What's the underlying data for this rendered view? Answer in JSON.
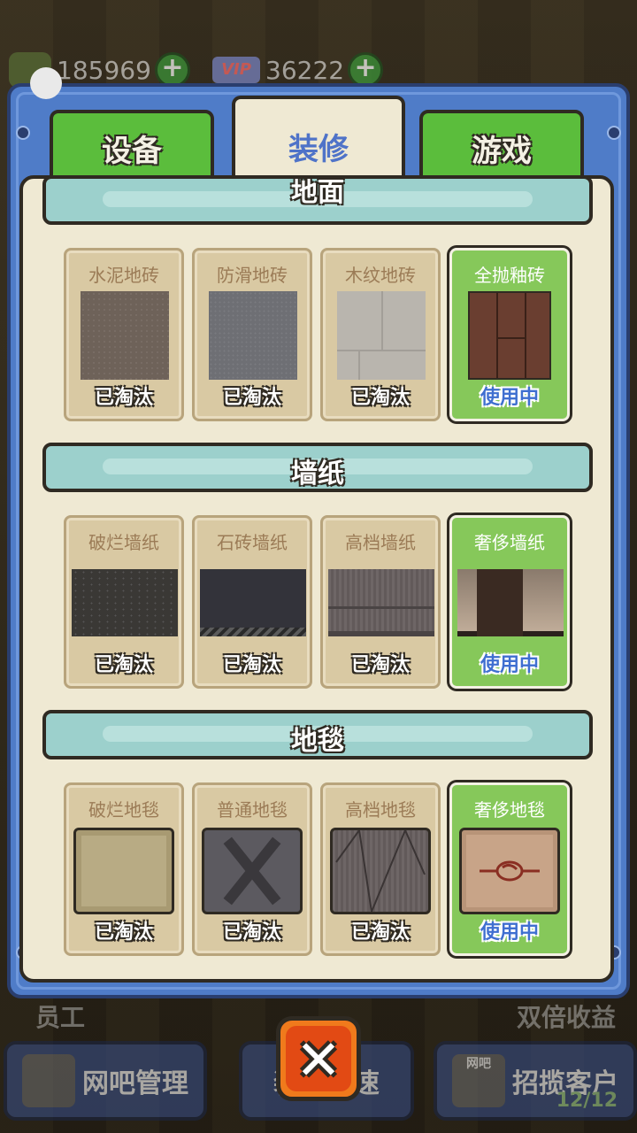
{
  "topbar": {
    "coins": "185969",
    "vip_points": "36222",
    "plus": "+"
  },
  "tabs": [
    {
      "label": "设备",
      "active": false
    },
    {
      "label": "装修",
      "active": true
    },
    {
      "label": "游戏",
      "active": false
    }
  ],
  "sections": [
    {
      "title": "地面",
      "items": [
        {
          "name": "水泥地砖",
          "status": "已淘汰"
        },
        {
          "name": "防滑地砖",
          "status": "已淘汰"
        },
        {
          "name": "木纹地砖",
          "status": "已淘汰"
        },
        {
          "name": "全抛釉砖",
          "status": "使用中"
        }
      ]
    },
    {
      "title": "墙纸",
      "items": [
        {
          "name": "破烂墙纸",
          "status": "已淘汰"
        },
        {
          "name": "石砖墙纸",
          "status": "已淘汰"
        },
        {
          "name": "高档墙纸",
          "status": "已淘汰"
        },
        {
          "name": "奢侈墙纸",
          "status": "使用中"
        }
      ]
    },
    {
      "title": "地毯",
      "items": [
        {
          "name": "破烂地毯",
          "status": "已淘汰"
        },
        {
          "name": "普通地毯",
          "status": "已淘汰"
        },
        {
          "name": "高档地毯",
          "status": "已淘汰"
        },
        {
          "name": "奢侈地毯",
          "status": "使用中"
        }
      ]
    }
  ],
  "bottom": {
    "left_label": "员工",
    "right_label": "双倍收益",
    "manage": "网吧管理",
    "center": "装修加速",
    "recruit": "招揽客户",
    "recruit_icon_text": "网吧",
    "guest_count": "12/12"
  },
  "close_symbol": "✕",
  "colors": {
    "frame": "#4f7cc8",
    "tab_green": "#5bbd3c",
    "panel": "#efe9d3",
    "header": "#9cd0cc",
    "close": "#f07a1c"
  }
}
